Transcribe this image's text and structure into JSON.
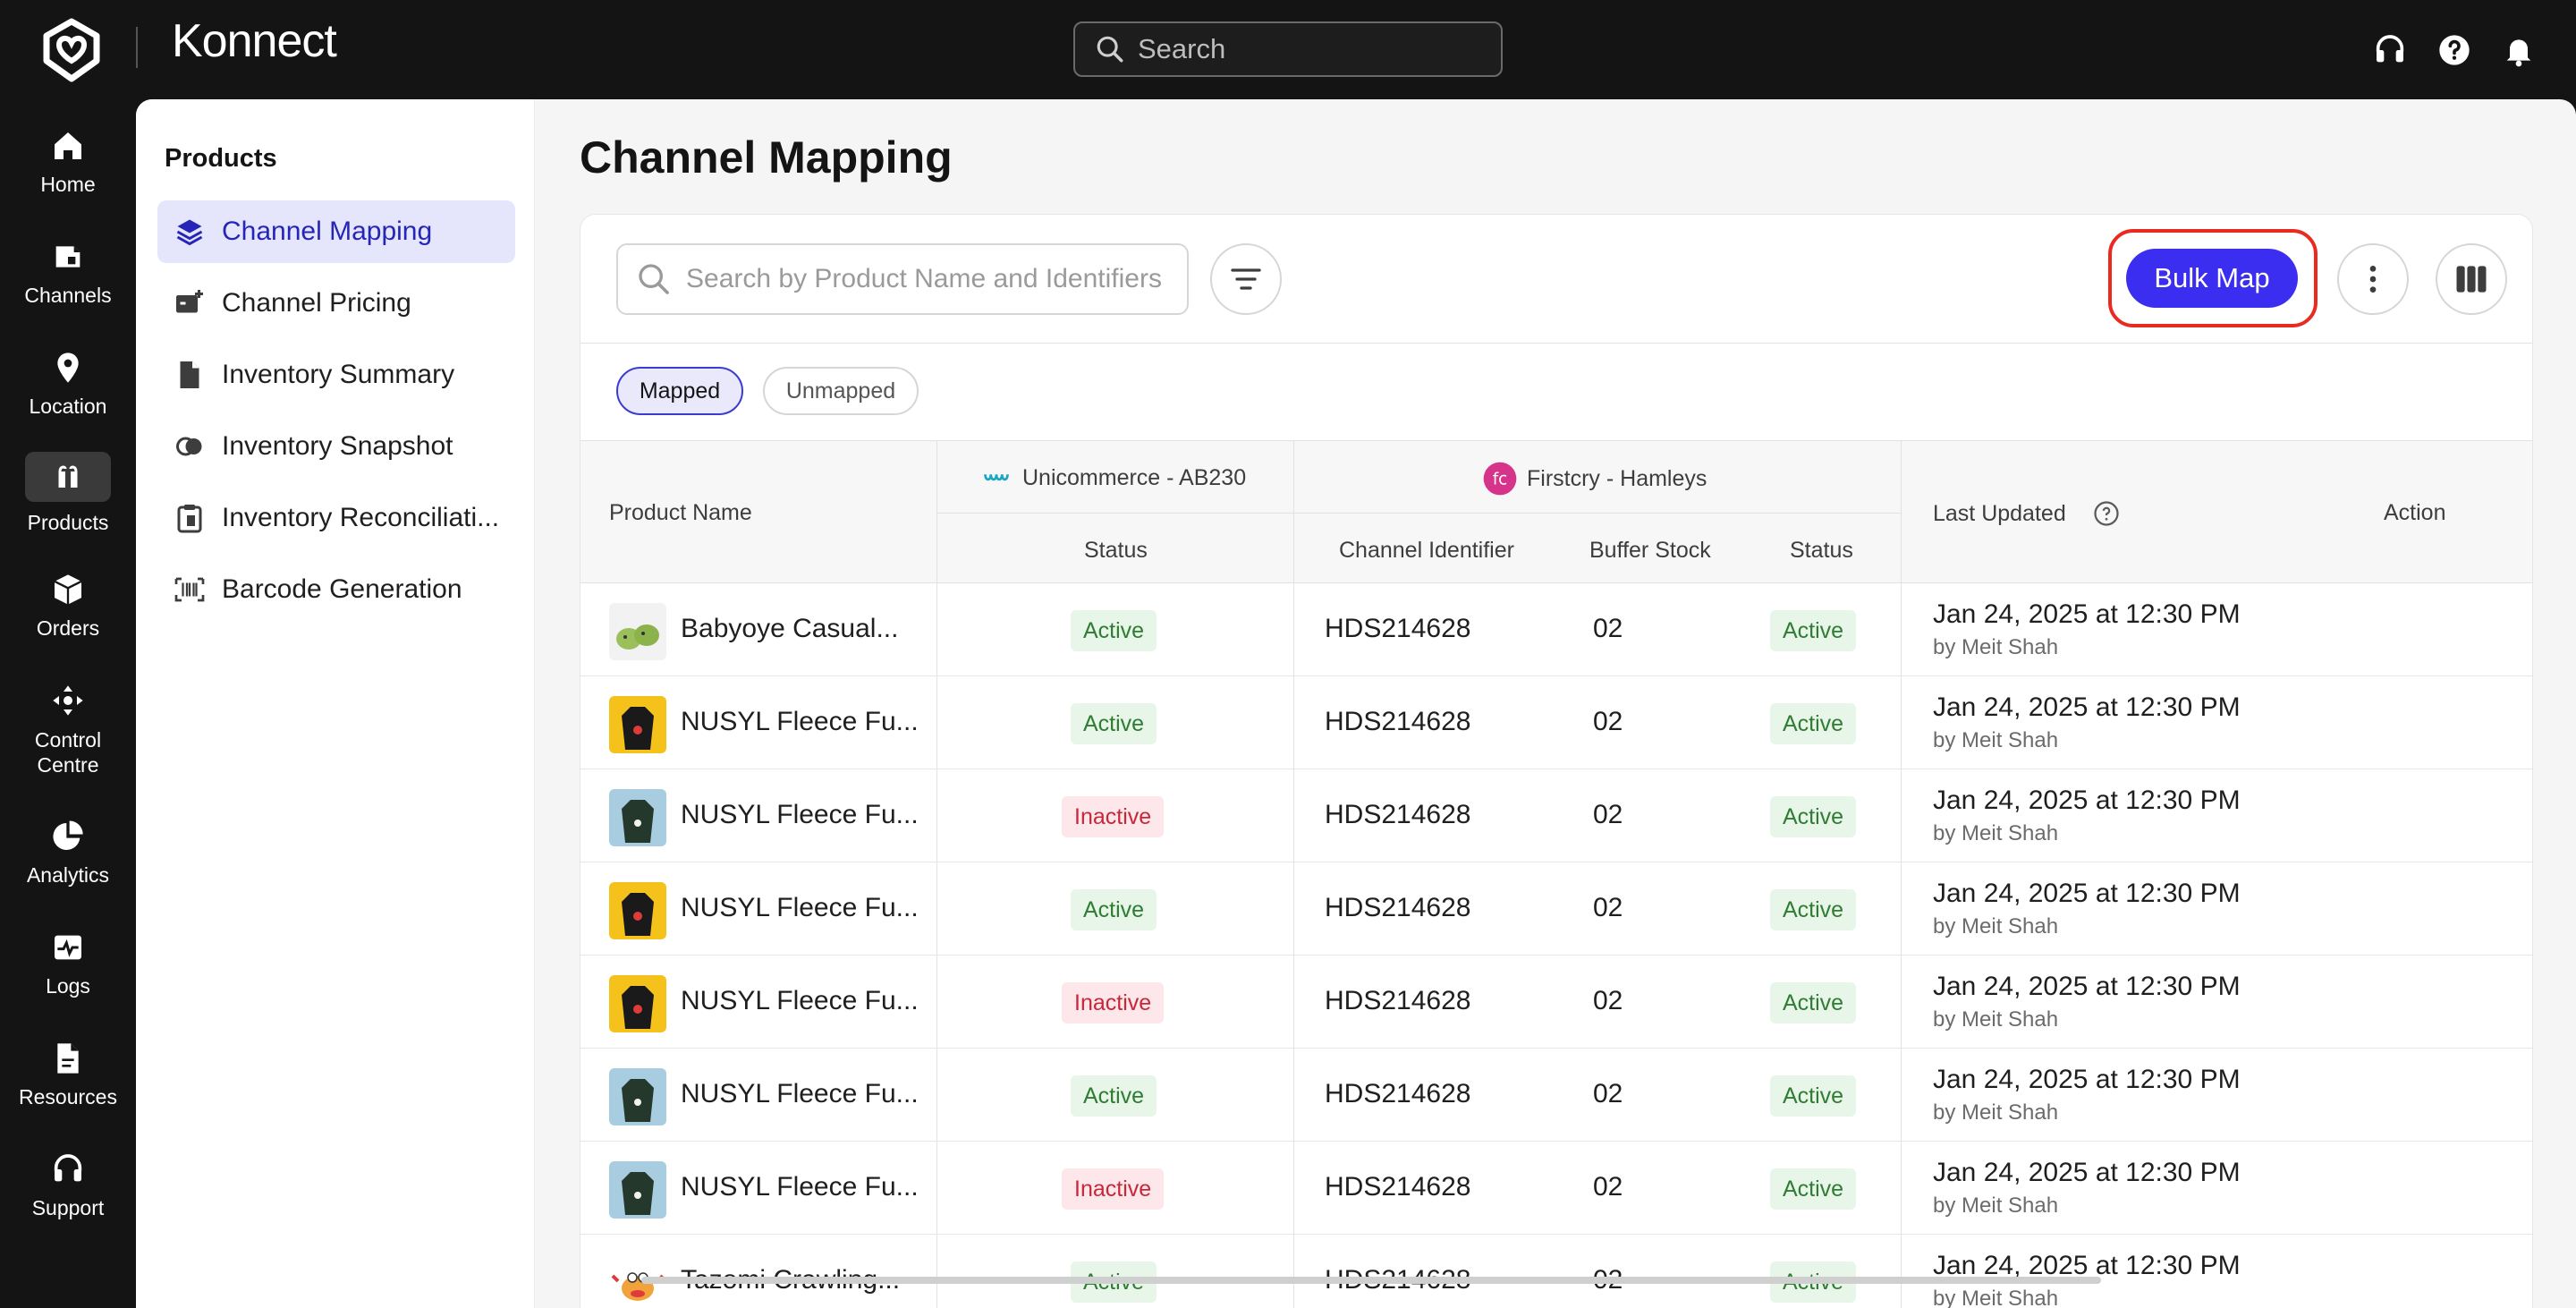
{
  "app": {
    "name": "Konnect"
  },
  "topbar": {
    "search_placeholder": "Search",
    "icons": [
      "headset-icon",
      "help-icon",
      "bell-icon"
    ]
  },
  "rail": {
    "items": [
      {
        "label": "Home",
        "icon": "home-icon"
      },
      {
        "label": "Channels",
        "icon": "channels-icon"
      },
      {
        "label": "Location",
        "icon": "location-pin-icon"
      },
      {
        "label": "Products",
        "icon": "products-icon",
        "active": true
      },
      {
        "label": "Orders",
        "icon": "box-icon"
      },
      {
        "label": "Control Centre",
        "icon": "control-centre-icon"
      },
      {
        "label": "Analytics",
        "icon": "pie-chart-icon"
      },
      {
        "label": "Logs",
        "icon": "logs-icon"
      },
      {
        "label": "Resources",
        "icon": "file-icon"
      },
      {
        "label": "Support",
        "icon": "headset-icon"
      }
    ]
  },
  "subnav": {
    "title": "Products",
    "items": [
      {
        "label": "Channel Mapping",
        "icon": "layers-icon",
        "active": true
      },
      {
        "label": "Channel Pricing",
        "icon": "pricing-icon"
      },
      {
        "label": "Inventory Summary",
        "icon": "document-icon"
      },
      {
        "label": "Inventory Snapshot",
        "icon": "snapshot-icon"
      },
      {
        "label": "Inventory Reconciliati...",
        "icon": "clipboard-icon"
      },
      {
        "label": "Barcode Generation",
        "icon": "barcode-icon"
      }
    ]
  },
  "page": {
    "title": "Channel Mapping",
    "search_placeholder": "Search by Product Name and Identifiers",
    "bulk_map_label": "Bulk Map",
    "chips": {
      "mapped": "Mapped",
      "unmapped": "Unmapped",
      "selected": "mapped"
    }
  },
  "table": {
    "headers": {
      "product_name": "Product Name",
      "group_unicommerce": "Unicommerce - AB230",
      "group_firstcry": "Firstcry - Hamleys",
      "status": "Status",
      "channel_identifier": "Channel Identifier",
      "buffer_stock": "Buffer Stock",
      "status2": "Status",
      "last_updated": "Last Updated",
      "action": "Action"
    },
    "rows": [
      {
        "name": "Babyoye Casual...",
        "uni_status": "Active",
        "identifier": "HDS214628",
        "buffer": "02",
        "fc_status": "Active",
        "date": "Jan 24, 2025 at 12:30 PM",
        "by": "by Meit Shah",
        "thumb": "green-shoes"
      },
      {
        "name": "NUSYL Fleece Fu...",
        "uni_status": "Active",
        "identifier": "HDS214628",
        "buffer": "02",
        "fc_status": "Active",
        "date": "Jan 24, 2025 at 12:30 PM",
        "by": "by Meit Shah",
        "thumb": "black-hoodie-yellow"
      },
      {
        "name": "NUSYL Fleece Fu...",
        "uni_status": "Inactive",
        "identifier": "HDS214628",
        "buffer": "02",
        "fc_status": "Active",
        "date": "Jan 24, 2025 at 12:30 PM",
        "by": "by Meit Shah",
        "thumb": "green-hoodie-blue"
      },
      {
        "name": "NUSYL Fleece Fu...",
        "uni_status": "Active",
        "identifier": "HDS214628",
        "buffer": "02",
        "fc_status": "Active",
        "date": "Jan 24, 2025 at 12:30 PM",
        "by": "by Meit Shah",
        "thumb": "black-hoodie-yellow"
      },
      {
        "name": "NUSYL Fleece Fu...",
        "uni_status": "Inactive",
        "identifier": "HDS214628",
        "buffer": "02",
        "fc_status": "Active",
        "date": "Jan 24, 2025 at 12:30 PM",
        "by": "by Meit Shah",
        "thumb": "black-hoodie-yellow"
      },
      {
        "name": "NUSYL Fleece Fu...",
        "uni_status": "Active",
        "identifier": "HDS214628",
        "buffer": "02",
        "fc_status": "Active",
        "date": "Jan 24, 2025 at 12:30 PM",
        "by": "by Meit Shah",
        "thumb": "green-hoodie-blue"
      },
      {
        "name": "NUSYL Fleece Fu...",
        "uni_status": "Inactive",
        "identifier": "HDS214628",
        "buffer": "02",
        "fc_status": "Active",
        "date": "Jan 24, 2025 at 12:30 PM",
        "by": "by Meit Shah",
        "thumb": "green-hoodie-blue"
      },
      {
        "name": "Tazomi Crawling...",
        "uni_status": "Active",
        "identifier": "HDS214628",
        "buffer": "02",
        "fc_status": "Active",
        "date": "Jan 24, 2025 at 12:30 PM",
        "by": "by Meit Shah",
        "thumb": "crab-toy"
      }
    ]
  },
  "colors": {
    "accent": "#3b2ef0",
    "highlight_ring": "#ea2a1e",
    "active_badge_bg": "#e8f6e9",
    "active_badge_text": "#2e7d32",
    "inactive_badge_bg": "#fde7ea",
    "inactive_badge_text": "#c62838",
    "firstcry_brand": "#d6338a",
    "unicommerce_brand": "#1aa7c4"
  }
}
